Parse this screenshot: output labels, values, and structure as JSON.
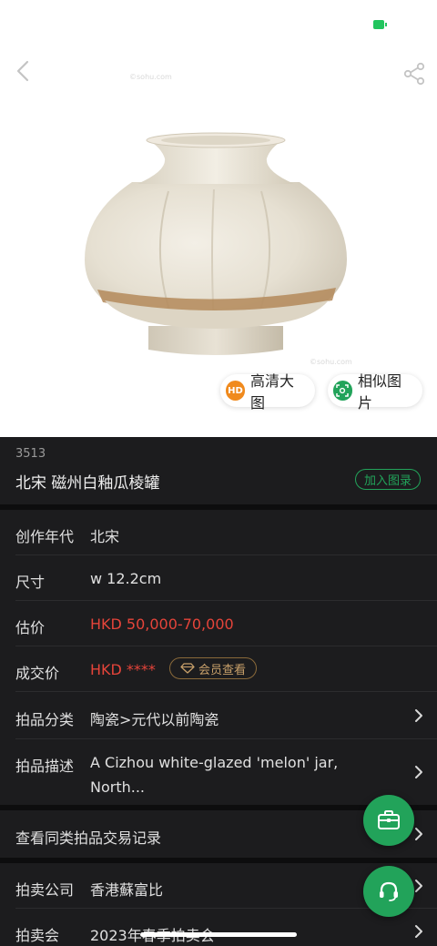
{
  "hero": {
    "watermark_top": "©sohu.com",
    "watermark_bottom": "©sohu.com",
    "hd_button": "高清大图",
    "hd_badge": "HD",
    "similar_button": "相似图片"
  },
  "lot": {
    "number": "3513",
    "title": "北宋 磁州白釉瓜棱罐",
    "catalog_button": "加入图录"
  },
  "details": [
    {
      "label": "创作年代",
      "value": "北宋"
    },
    {
      "label": "尺寸",
      "value": "w 12.2cm"
    },
    {
      "label": "估价",
      "value": "HKD  50,000-70,000"
    },
    {
      "label": "成交价",
      "value": "HKD ****",
      "member_button": "会员查看"
    },
    {
      "label": "拍品分类",
      "value": "陶瓷>元代以前陶瓷"
    },
    {
      "label": "拍品描述",
      "value_line1": "A Cizhou white-glazed 'melon' jar,",
      "value_line2": "North..."
    }
  ],
  "records_link": "查看同类拍品交易记录",
  "auction": [
    {
      "label": "拍卖公司",
      "value": "香港蘇富比"
    },
    {
      "label": "拍卖会",
      "value": "2023年春季拍卖会"
    }
  ],
  "colors": {
    "accent_green": "#22a35a",
    "price_red": "#e5443a",
    "hd_orange": "#f08a1d",
    "background": "#1c1c1e"
  },
  "icons": [
    "back-arrow-icon",
    "share-icon",
    "hd-icon",
    "similar-image-icon",
    "diamond-icon",
    "chevron-right-icon",
    "briefcase-icon",
    "headset-icon"
  ]
}
